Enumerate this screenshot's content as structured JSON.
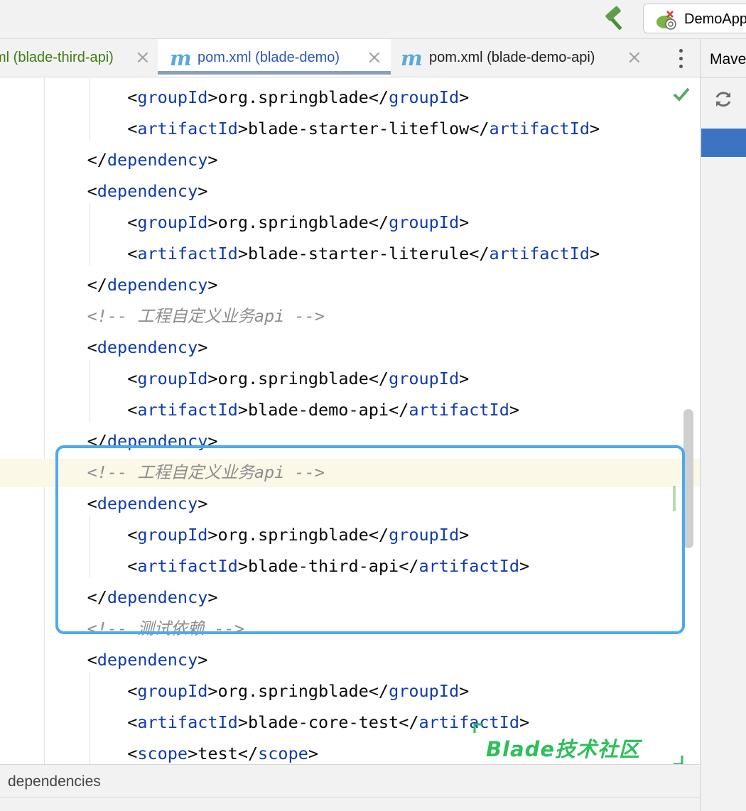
{
  "toolbar": {
    "build_icon": "hammer-icon",
    "run_config_label": "DemoApp",
    "run_config_icon": "spring-boot-run-config-icon"
  },
  "tabs": [
    {
      "label": "ml (blade-third-api)",
      "icon": "maven-icon",
      "color": "#3d7d12",
      "active": false
    },
    {
      "label": "pom.xml (blade-demo)",
      "icon": "maven-icon",
      "color": "#2a57b4",
      "active": true
    },
    {
      "label": "pom.xml (blade-demo-api)",
      "icon": "maven-icon",
      "color": "#1e1e1e",
      "active": false
    }
  ],
  "tab_icon_glyph": "m",
  "tab_close_glyph": "×",
  "maven_panel": {
    "title": "Mave",
    "refresh_icon": "refresh-icon"
  },
  "code_lines": [
    {
      "indent": "        ",
      "parts": [
        {
          "t": "<"
        },
        {
          "t": "groupId",
          "c": "tag"
        },
        {
          "t": ">org.springblade</"
        },
        {
          "t": "groupId",
          "c": "tag"
        },
        {
          "t": ">"
        }
      ]
    },
    {
      "indent": "        ",
      "parts": [
        {
          "t": "<"
        },
        {
          "t": "artifactId",
          "c": "tag"
        },
        {
          "t": ">blade-starter-liteflow</"
        },
        {
          "t": "artifactId",
          "c": "tag"
        },
        {
          "t": ">"
        }
      ]
    },
    {
      "indent": "    ",
      "parts": [
        {
          "t": "</"
        },
        {
          "t": "dependency",
          "c": "tag"
        },
        {
          "t": ">"
        }
      ]
    },
    {
      "indent": "    ",
      "parts": [
        {
          "t": "<"
        },
        {
          "t": "dependency",
          "c": "tag"
        },
        {
          "t": ">"
        }
      ]
    },
    {
      "indent": "        ",
      "parts": [
        {
          "t": "<"
        },
        {
          "t": "groupId",
          "c": "tag"
        },
        {
          "t": ">org.springblade</"
        },
        {
          "t": "groupId",
          "c": "tag"
        },
        {
          "t": ">"
        }
      ]
    },
    {
      "indent": "        ",
      "parts": [
        {
          "t": "<"
        },
        {
          "t": "artifactId",
          "c": "tag"
        },
        {
          "t": ">blade-starter-literule</"
        },
        {
          "t": "artifactId",
          "c": "tag"
        },
        {
          "t": ">"
        }
      ]
    },
    {
      "indent": "    ",
      "parts": [
        {
          "t": "</"
        },
        {
          "t": "dependency",
          "c": "tag"
        },
        {
          "t": ">"
        }
      ]
    },
    {
      "indent": "    ",
      "parts": [
        {
          "t": "<!-- 工程自定义业务api -->",
          "c": "cmt"
        }
      ]
    },
    {
      "indent": "    ",
      "parts": [
        {
          "t": "<"
        },
        {
          "t": "dependency",
          "c": "tag"
        },
        {
          "t": ">"
        }
      ]
    },
    {
      "indent": "        ",
      "parts": [
        {
          "t": "<"
        },
        {
          "t": "groupId",
          "c": "tag"
        },
        {
          "t": ">org.springblade</"
        },
        {
          "t": "groupId",
          "c": "tag"
        },
        {
          "t": ">"
        }
      ]
    },
    {
      "indent": "        ",
      "parts": [
        {
          "t": "<"
        },
        {
          "t": "artifactId",
          "c": "tag"
        },
        {
          "t": ">blade-demo-api</"
        },
        {
          "t": "artifactId",
          "c": "tag"
        },
        {
          "t": ">"
        }
      ]
    },
    {
      "indent": "    ",
      "parts": [
        {
          "t": "</"
        },
        {
          "t": "dependency",
          "c": "tag"
        },
        {
          "t": ">"
        }
      ]
    },
    {
      "indent": "    ",
      "parts": [
        {
          "t": "<!-- 工程自定义业务api -->",
          "c": "cmt"
        }
      ]
    },
    {
      "indent": "    ",
      "parts": [
        {
          "t": "<"
        },
        {
          "t": "dependency",
          "c": "tag"
        },
        {
          "t": ">"
        }
      ]
    },
    {
      "indent": "        ",
      "parts": [
        {
          "t": "<"
        },
        {
          "t": "groupId",
          "c": "tag"
        },
        {
          "t": ">org.springblade</"
        },
        {
          "t": "groupId",
          "c": "tag"
        },
        {
          "t": ">"
        }
      ]
    },
    {
      "indent": "        ",
      "parts": [
        {
          "t": "<"
        },
        {
          "t": "artifactId",
          "c": "tag"
        },
        {
          "t": ">blade-third-api</"
        },
        {
          "t": "artifactId",
          "c": "tag"
        },
        {
          "t": ">"
        }
      ]
    },
    {
      "indent": "    ",
      "parts": [
        {
          "t": "</"
        },
        {
          "t": "dependency",
          "c": "tag"
        },
        {
          "t": ">"
        }
      ]
    },
    {
      "indent": "    ",
      "parts": [
        {
          "t": "<!-- 测试依赖 -->",
          "c": "cmt"
        }
      ]
    },
    {
      "indent": "    ",
      "parts": [
        {
          "t": "<"
        },
        {
          "t": "dependency",
          "c": "tag"
        },
        {
          "t": ">"
        }
      ]
    },
    {
      "indent": "        ",
      "parts": [
        {
          "t": "<"
        },
        {
          "t": "groupId",
          "c": "tag"
        },
        {
          "t": ">org.springblade</"
        },
        {
          "t": "groupId",
          "c": "tag"
        },
        {
          "t": ">"
        }
      ]
    },
    {
      "indent": "        ",
      "parts": [
        {
          "t": "<"
        },
        {
          "t": "artifactId",
          "c": "tag"
        },
        {
          "t": ">blade-core-test</"
        },
        {
          "t": "artifactId",
          "c": "tag"
        },
        {
          "t": ">"
        }
      ]
    },
    {
      "indent": "        ",
      "parts": [
        {
          "t": "<"
        },
        {
          "t": "scope",
          "c": "tag"
        },
        {
          "t": ">test</"
        },
        {
          "t": "scope",
          "c": "tag"
        },
        {
          "t": ">"
        }
      ]
    }
  ],
  "editor": {
    "inspection_status_icon": "check-icon",
    "highlight_color": "#4baaf0"
  },
  "watermark": {
    "text": "Blade技术社区",
    "color": "#2fbf5b"
  },
  "breadcrumb": {
    "text": "dependencies"
  }
}
